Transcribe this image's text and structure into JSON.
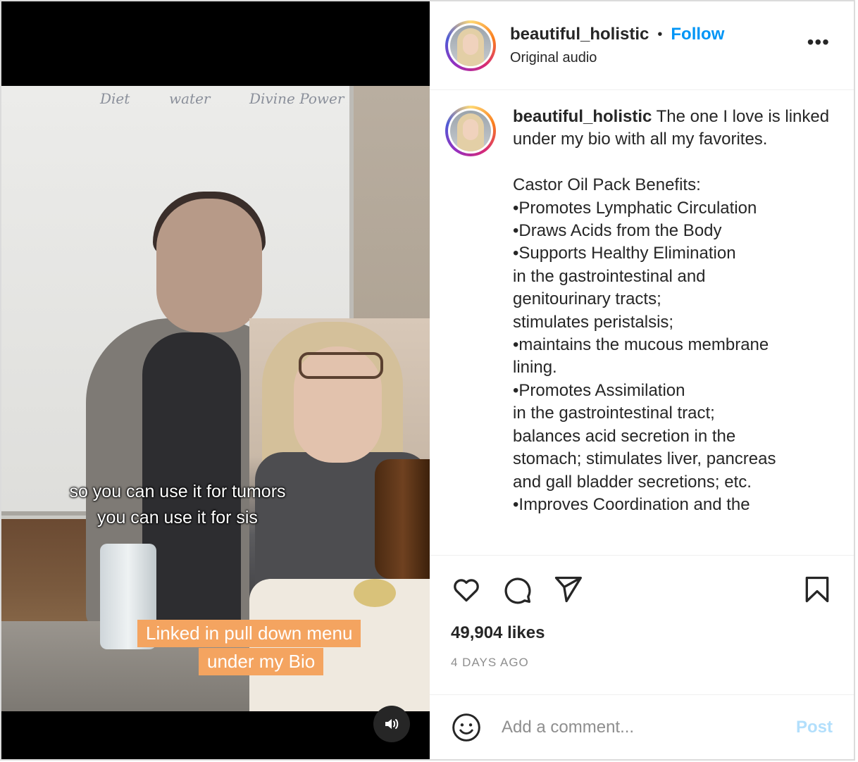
{
  "video": {
    "board_words": [
      "Diet",
      "water",
      "Divine Power"
    ],
    "caption_line1": "so you can use it for tumors",
    "caption_line2": "you can use it for sis",
    "banner_line1": "Linked in pull down menu",
    "banner_line2": "under my Bio",
    "audio_icon": "speaker-icon"
  },
  "header": {
    "username": "beautiful_holistic",
    "separator": "•",
    "follow_label": "Follow",
    "audio_label": "Original audio",
    "more_label": "•••"
  },
  "caption": {
    "username": "beautiful_holistic",
    "text": " The one I love is linked under my bio with all my favorites.\n\nCastor Oil Pack Benefits:\n•Promotes Lymphatic Circulation\n•Draws Acids from the Body\n•Supports Healthy Elimination\nin the gastrointestinal and\ngenitourinary tracts;\nstimulates peristalsis;\n•maintains the mucous membrane\nlining.\n•Promotes Assimilation\nin the gastrointestinal tract;\nbalances acid secretion in the\nstomach; stimulates liver, pancreas\nand gall bladder secretions; etc.\n•Improves Coordination and the"
  },
  "actions": {
    "icons": [
      "heart-icon",
      "comment-icon",
      "share-icon",
      "bookmark-icon"
    ],
    "likes": "49,904 likes",
    "timestamp": "4 DAYS AGO"
  },
  "comment": {
    "placeholder": "Add a comment...",
    "post_label": "Post"
  },
  "colors": {
    "follow_blue": "#0095f6",
    "post_disabled": "#b2dffc",
    "banner_orange": "#f4a460"
  }
}
